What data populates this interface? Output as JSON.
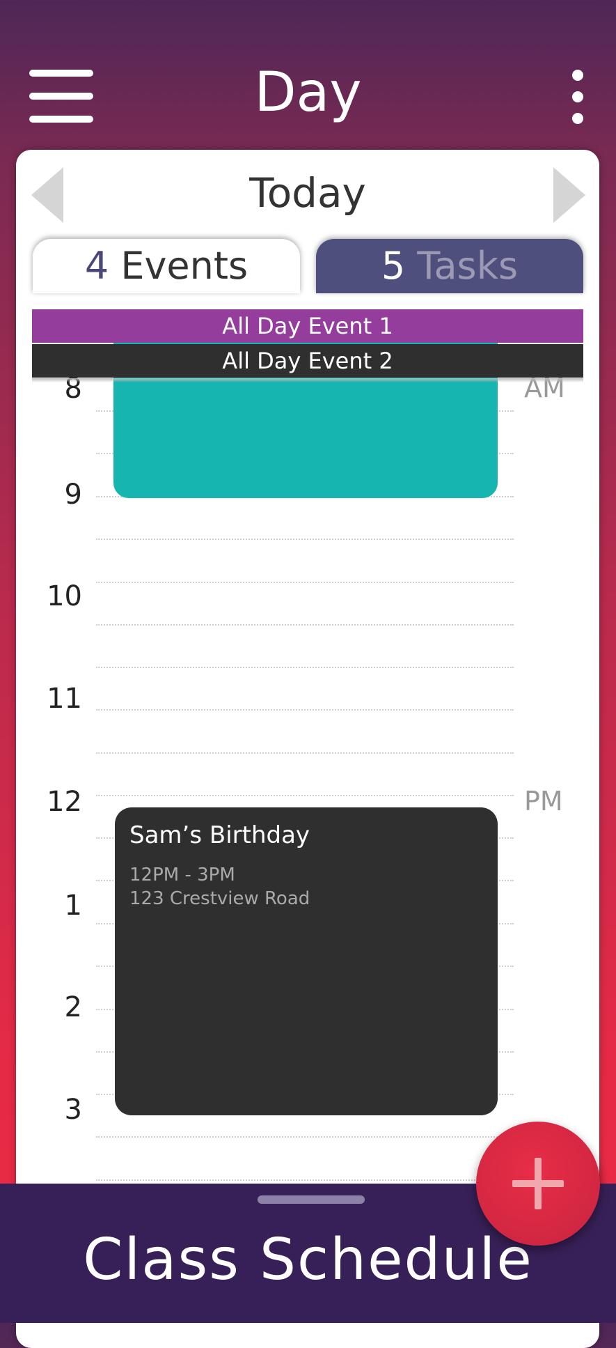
{
  "header": {
    "title": "Day"
  },
  "nav": {
    "date_label": "Today"
  },
  "tabs": {
    "events": {
      "count": "4",
      "label": "Events"
    },
    "tasks": {
      "count": "5",
      "label": "Tasks"
    }
  },
  "all_day_events": [
    "All Day Event 1",
    "All Day Event 2"
  ],
  "hours": [
    "8",
    "9",
    "10",
    "11",
    "12",
    "1",
    "2",
    "3"
  ],
  "meridiem": {
    "am": "AM",
    "pm": "PM"
  },
  "events": {
    "birthday": {
      "title": "Sam’s Birthday",
      "time": "12PM - 3PM",
      "location": "123 Crestview Road"
    }
  },
  "footer": {
    "title": "Class Schedule"
  },
  "colors": {
    "all_day_1": "#943d9c",
    "all_day_2": "#2f2f2f",
    "teal_event": "#17b5b0",
    "birthday_event": "#2f2f2f",
    "fab": "#e52a46",
    "bottom_bar": "#372057"
  }
}
